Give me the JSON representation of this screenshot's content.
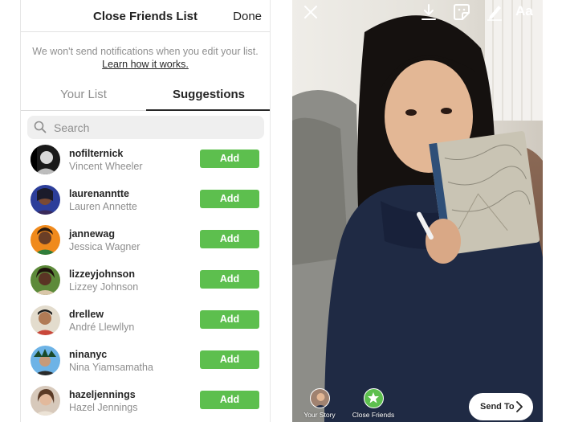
{
  "header": {
    "title": "Close Friends List",
    "done_label": "Done"
  },
  "notice": {
    "text": "We won't send notifications when you edit your list.",
    "link": "Learn how it works."
  },
  "tabs": [
    {
      "label": "Your List",
      "active": false
    },
    {
      "label": "Suggestions",
      "active": true
    }
  ],
  "search": {
    "placeholder": "Search"
  },
  "suggestions": [
    {
      "username": "nofilternick",
      "full_name": "Vincent Wheeler",
      "action": "Add"
    },
    {
      "username": "laurenanntte",
      "full_name": "Lauren Annette",
      "action": "Add"
    },
    {
      "username": "jannewag",
      "full_name": "Jessica Wagner",
      "action": "Add"
    },
    {
      "username": "lizzeyjohnson",
      "full_name": "Lizzey Johnson",
      "action": "Add"
    },
    {
      "username": "drellew",
      "full_name": "André Llewllyn",
      "action": "Add"
    },
    {
      "username": "ninanyc",
      "full_name": "Nina Yiamsamatha",
      "action": "Add"
    },
    {
      "username": "hazeljennings",
      "full_name": "Hazel Jennings",
      "action": "Add"
    }
  ],
  "story": {
    "top_icons": [
      "close-icon",
      "download-icon",
      "sticker-icon",
      "pen-icon",
      "text-icon"
    ],
    "text_tool_label": "Aa",
    "share_targets": [
      {
        "label": "Your Story"
      },
      {
        "label": "Close Friends"
      }
    ],
    "send_label": "Send To"
  },
  "colors": {
    "add_button": "#5dbf4e",
    "close_friends_badge": "#5dbf4e",
    "text_primary": "#262626",
    "text_secondary": "#8e8e8e"
  }
}
